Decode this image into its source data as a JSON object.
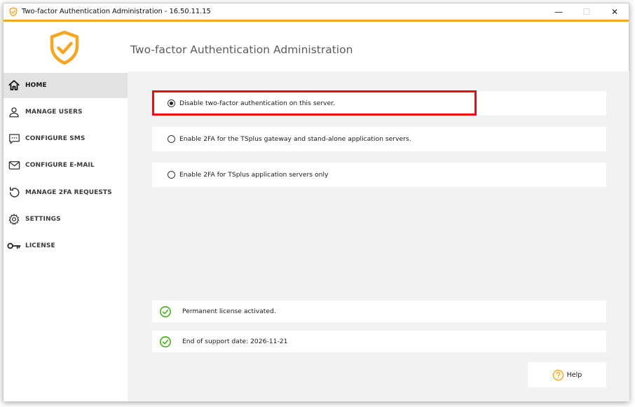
{
  "window": {
    "title": "Two-factor Authentication Administration - 16.50.11.15",
    "controls": {
      "minimize": "—",
      "maximize": "☐",
      "close": "✕"
    }
  },
  "header": {
    "title": "Two-factor Authentication Administration"
  },
  "sidebar": {
    "items": [
      {
        "label": "HOME",
        "icon": "home-icon",
        "active": true
      },
      {
        "label": "MANAGE USERS",
        "icon": "user-icon",
        "active": false
      },
      {
        "label": "CONFIGURE SMS",
        "icon": "sms-icon",
        "active": false
      },
      {
        "label": "CONFIGURE E-MAIL",
        "icon": "email-icon",
        "active": false
      },
      {
        "label": "MANAGE 2FA REQUESTS",
        "icon": "undo-icon",
        "active": false
      },
      {
        "label": "SETTINGS",
        "icon": "gear-icon",
        "active": false
      },
      {
        "label": "LICENSE",
        "icon": "key-icon",
        "active": false
      }
    ]
  },
  "options": [
    {
      "label": "Disable two-factor authentication on this server.",
      "checked": true
    },
    {
      "label": "Enable 2FA for the TSplus gateway and stand-alone application servers.",
      "checked": false
    },
    {
      "label": "Enable 2FA for TSplus application servers only",
      "checked": false
    }
  ],
  "status": [
    {
      "text": "Permanent license activated.",
      "icon": "check-circle-icon"
    },
    {
      "text": "End of support date: 2026-11-21",
      "icon": "check-circle-icon"
    }
  ],
  "help": {
    "label": "Help"
  },
  "colors": {
    "accent": "#f5a623",
    "highlight": "#e0101a",
    "success": "#4caf22",
    "content_bg": "#f2f2f2",
    "active_nav": "#e3e3e3"
  }
}
